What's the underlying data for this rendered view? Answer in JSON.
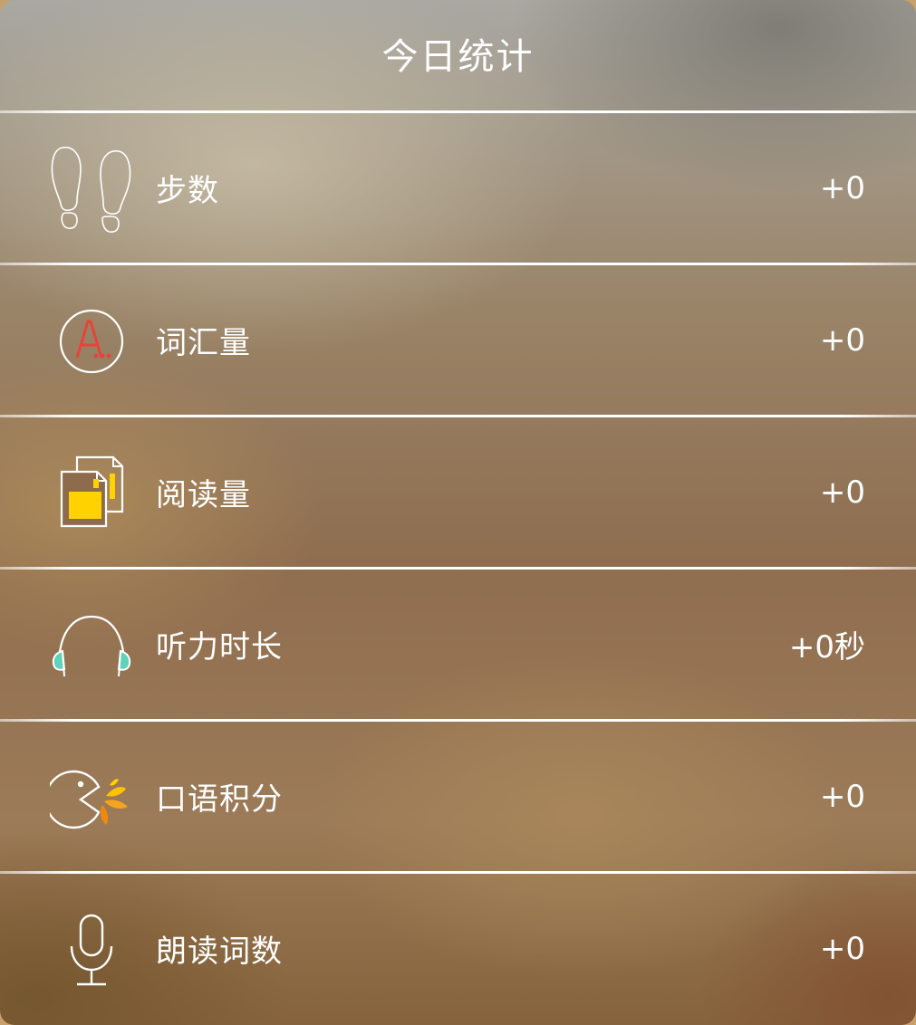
{
  "header": {
    "title": "今日统计"
  },
  "stats": [
    {
      "icon": "footprints-icon",
      "label": "步数",
      "value": "+0"
    },
    {
      "icon": "vocabulary-icon",
      "label": "词汇量",
      "value": "+0"
    },
    {
      "icon": "reading-icon",
      "label": "阅读量",
      "value": "+0"
    },
    {
      "icon": "headphones-icon",
      "label": "听力时长",
      "value": "+0秒"
    },
    {
      "icon": "speaking-icon",
      "label": "口语积分",
      "value": "+0"
    },
    {
      "icon": "microphone-icon",
      "label": "朗读词数",
      "value": "+0"
    }
  ],
  "colors": {
    "vocabulary_accent": "#e8433a",
    "reading_accent": "#ffd200",
    "headphones_accent": "#5fd3b8",
    "speaking_accent": "#f5a41c"
  }
}
